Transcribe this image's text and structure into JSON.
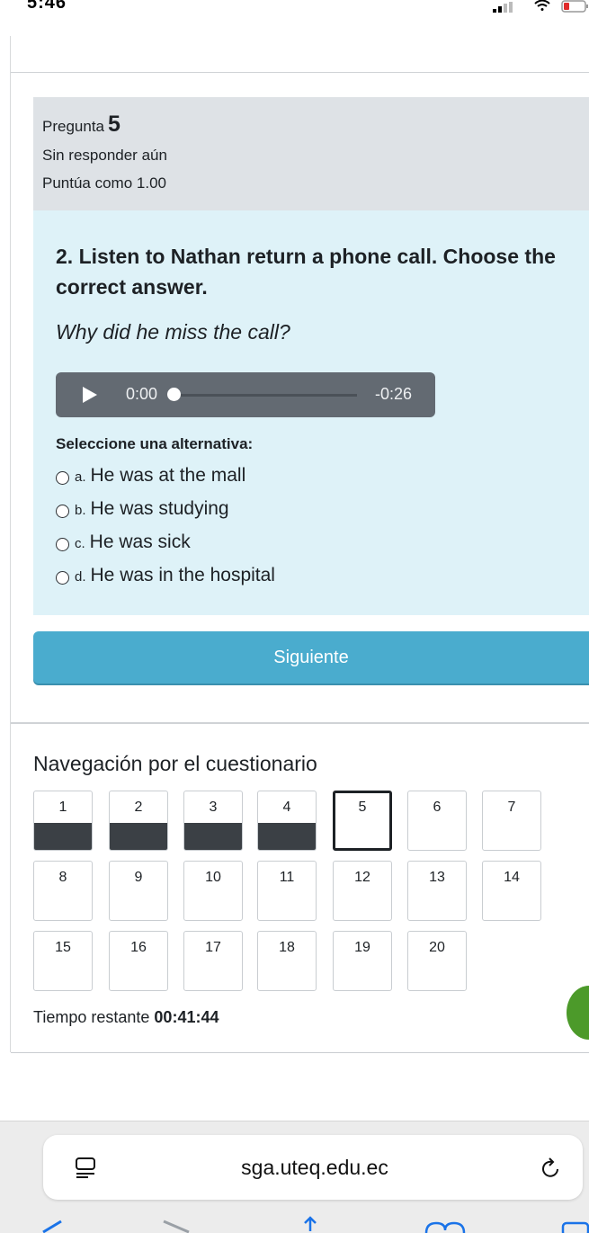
{
  "status_bar": {
    "time": "5:46"
  },
  "question_info": {
    "label": "Pregunta",
    "number": "5",
    "state": "Sin responder aún",
    "grade": "Puntúa como 1.00"
  },
  "question": {
    "text": "2. Listen to Nathan return a phone call. Choose the correct answer.",
    "subtext": "Why did he miss the call?",
    "audio": {
      "current_time": "0:00",
      "remaining_time": "-0:26",
      "progress": 0.0
    },
    "prompt": "Seleccione una alternativa:",
    "answers": [
      {
        "num": "a.",
        "text": "He was at the mall"
      },
      {
        "num": "b.",
        "text": "He was studying"
      },
      {
        "num": "c.",
        "text": "He was sick"
      },
      {
        "num": "d.",
        "text": "He was in the hospital"
      }
    ]
  },
  "next_button": {
    "label": "Siguiente"
  },
  "navigation": {
    "title": "Navegación por el cuestionario",
    "items": [
      {
        "label": "1",
        "state": "answered"
      },
      {
        "label": "2",
        "state": "answered"
      },
      {
        "label": "3",
        "state": "answered"
      },
      {
        "label": "4",
        "state": "answered"
      },
      {
        "label": "5",
        "state": "current"
      },
      {
        "label": "6",
        "state": "unanswered"
      },
      {
        "label": "7",
        "state": "unanswered"
      },
      {
        "label": "8",
        "state": "unanswered"
      },
      {
        "label": "9",
        "state": "unanswered"
      },
      {
        "label": "10",
        "state": "unanswered"
      },
      {
        "label": "11",
        "state": "unanswered"
      },
      {
        "label": "12",
        "state": "unanswered"
      },
      {
        "label": "13",
        "state": "unanswered"
      },
      {
        "label": "14",
        "state": "unanswered"
      },
      {
        "label": "15",
        "state": "unanswered"
      },
      {
        "label": "16",
        "state": "unanswered"
      },
      {
        "label": "17",
        "state": "unanswered"
      },
      {
        "label": "18",
        "state": "unanswered"
      },
      {
        "label": "19",
        "state": "unanswered"
      },
      {
        "label": "20",
        "state": "unanswered"
      }
    ]
  },
  "timer": {
    "label": "Tiempo restante",
    "value": "00:41:44"
  },
  "browser": {
    "url": "sga.uteq.edu.ec"
  },
  "colors": {
    "accent": "#4aacce",
    "question_bg": "#def2f8",
    "info_bg": "#dee2e6",
    "answered": "#3b4045"
  }
}
